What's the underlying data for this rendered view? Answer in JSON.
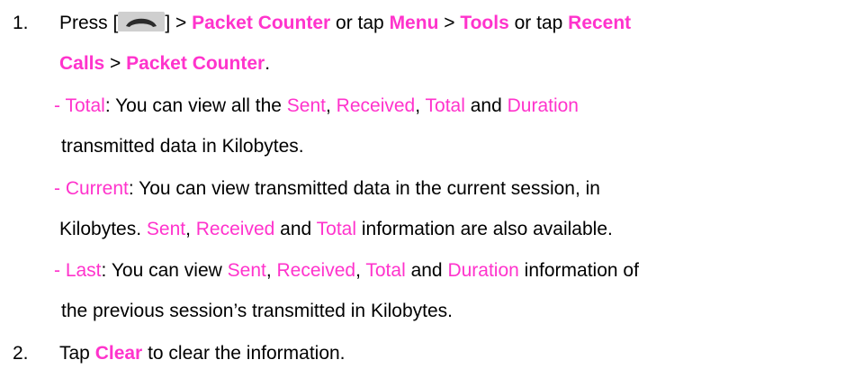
{
  "step1": {
    "num": "1.",
    "press": "Press [",
    "key_icon": "end-call-key-icon",
    "after_key": "] > ",
    "packet_counter": "Packet Counter",
    "or_tap1": " or tap ",
    "menu": "Menu",
    "gt1": " > ",
    "tools": "Tools",
    "or_tap2": " or tap ",
    "recent": "Recent",
    "calls": "Calls",
    "gt2": " > ",
    "packet_counter2": "Packet Counter",
    "period": "."
  },
  "total": {
    "dash": "- ",
    "label": "Total",
    "t1": ": You can view all the ",
    "sent": "Sent",
    "c1": ", ",
    "received": "Received",
    "c2": ", ",
    "total": "Total",
    "and": " and ",
    "duration": "Duration",
    "line2": "transmitted data in Kilobytes."
  },
  "current": {
    "dash": "- ",
    "label": "Current",
    "t1": ": You can view transmitted data in the current session, in",
    "l2a": "Kilobytes. ",
    "sent": "Sent",
    "c1": ", ",
    "received": "Received",
    "and": " and ",
    "total": "Total",
    "l2b": " information are also available."
  },
  "last": {
    "dash": "- ",
    "label": "Last",
    "t1": ": You can view ",
    "sent": "Sent",
    "c1": ", ",
    "received": "Received",
    "c2": ", ",
    "total": "Total",
    "and": " and ",
    "duration": "Duration",
    "t2": " information of",
    "line2": "the previous session’s transmitted in Kilobytes."
  },
  "step2": {
    "num": "2.",
    "tap": "Tap ",
    "clear": "Clear",
    "rest": " to clear the information."
  },
  "colors": {
    "highlight": "#ff33cc",
    "text": "#000000",
    "key_bg": "#cfcfcf"
  }
}
